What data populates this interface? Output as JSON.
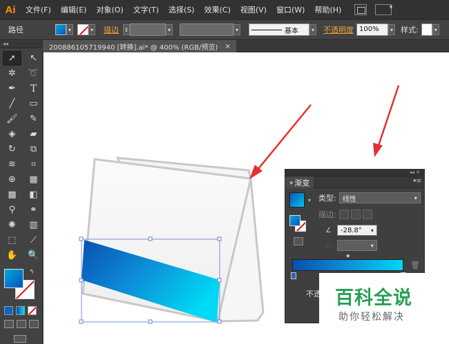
{
  "app": {
    "logo": "Ai"
  },
  "menus": [
    "文件(F)",
    "编辑(E)",
    "对象(O)",
    "文字(T)",
    "选择(S)",
    "效果(C)",
    "视图(V)",
    "窗口(W)",
    "帮助(H)"
  ],
  "control_bar": {
    "object_type": "路径",
    "stroke_label": "描边",
    "stroke_style": "基本",
    "opacity_label": "不透明度",
    "opacity_value": "100%",
    "style_label": "样式:"
  },
  "toolbar": {
    "collapse": "◂◂"
  },
  "document_tab": {
    "title": "200886105719940 [转换].ai* @ 400% (RGB/预览)",
    "close": "×"
  },
  "gradient_panel": {
    "header_controls": "◂◂ ✕",
    "tab_label": "渐变",
    "type_label": "类型:",
    "type_value": "线性",
    "stroke_label": "描边:",
    "angle_value": "-28.8°",
    "opacity_label": "不透"
  },
  "watermark": {
    "title": "百科全说",
    "subtitle": "助你轻松解决"
  },
  "colors": {
    "gradient_start": "#0a4fb0",
    "gradient_end": "#00d8f4",
    "accent_orange": "#f0a03c",
    "arrow_red": "#e53030",
    "watermark_green": "#27a055"
  }
}
